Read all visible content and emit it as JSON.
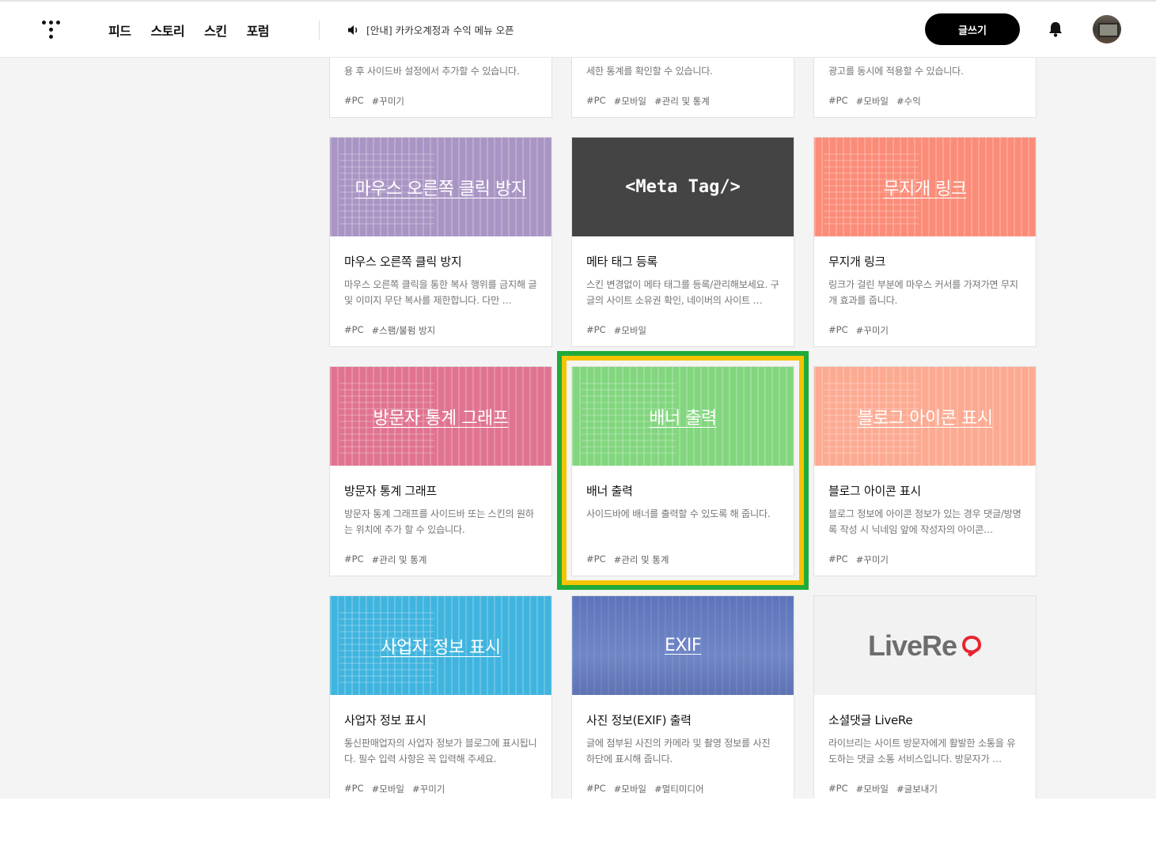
{
  "header": {
    "nav": [
      "피드",
      "스토리",
      "스킨",
      "포럼"
    ],
    "notice": "[안내] 카카오계정과 수익 메뉴 오픈",
    "write_button": "글쓰기"
  },
  "cards": [
    {
      "thumb_text": "",
      "title": "",
      "desc": "용 후 사이드바 설정에서 추가할 수 있습니다.",
      "tags": [
        "#PC",
        "#꾸미기"
      ],
      "color": "#ffffff"
    },
    {
      "thumb_text": "",
      "title": "",
      "desc": "세한 통계를 확인할 수 있습니다.",
      "tags": [
        "#PC",
        "#모바일",
        "#관리 및 통계"
      ],
      "color": "#ffffff"
    },
    {
      "thumb_text": "",
      "title": "",
      "desc": "광고를 동시에 적용할 수 있습니다.",
      "tags": [
        "#PC",
        "#모바일",
        "#수익"
      ],
      "color": "#ffffff"
    },
    {
      "thumb_text": "마우스 오른쪽 클릭 방지",
      "title": "마우스 오른쪽 클릭 방지",
      "desc": "마우스 오른쪽 클릭을 통한 복사 행위를 금지해 글 및 이미지 무단 복사를 제한합니다. 다만 …",
      "tags": [
        "#PC",
        "#스팸/불펌 방지"
      ],
      "color": "#a995c4"
    },
    {
      "thumb_text": "<Meta Tag/>",
      "title": "메타 태그 등록",
      "desc": "스킨 변경없이 메타 태그를 등록/관리해보세요. 구글의 사이트 소유권 확인, 네이버의 사이트 …",
      "tags": [
        "#PC",
        "#모바일"
      ],
      "color": "#444444"
    },
    {
      "thumb_text": "무지개 링크",
      "title": "무지개 링크",
      "desc": "링크가 걸린 부분에 마우스 커서를 가져가면 무지개 효과를 줍니다.",
      "tags": [
        "#PC",
        "#꾸미기"
      ],
      "color": "#fb8c78"
    },
    {
      "thumb_text": "방문자 통계 그래프",
      "title": "방문자 통계 그래프",
      "desc": "방문자 통계 그래프를 사이드바 또는 스킨의 원하는 위치에 추가 할 수 있습니다.",
      "tags": [
        "#PC",
        "#관리 및 통계"
      ],
      "color": "#e07390"
    },
    {
      "thumb_text": "배너 출력",
      "title": "배너 출력",
      "desc": "사이드바에 배너를 출력할 수 있도록 해 줍니다.",
      "tags": [
        "#PC",
        "#관리 및 통계"
      ],
      "color": "#82d67e"
    },
    {
      "thumb_text": "블로그 아이콘 표시",
      "title": "블로그 아이콘 표시",
      "desc": "블로그 정보에 아이콘 정보가 있는 경우 댓글/방명록 작성 시 닉네임 앞에 작성자의 아이콘…",
      "tags": [
        "#PC",
        "#꾸미기"
      ],
      "color": "#fdaa92"
    },
    {
      "thumb_text": "사업자 정보 표시",
      "title": "사업자 정보 표시",
      "desc": "통신판매업자의 사업자 정보가 블로그에 표시됩니다. 필수 입력 사항은 꼭 입력해 주세요.",
      "tags": [
        "#PC",
        "#모바일",
        "#꾸미기"
      ],
      "color": "#3fb4de"
    },
    {
      "thumb_text": "EXIF",
      "title": "사진 정보(EXIF) 출력",
      "desc": "글에 첨부된 사진의 카메라 및 촬영 정보를 사진 하단에 표시해 줍니다.",
      "tags": [
        "#PC",
        "#모바일",
        "#멀티미디어"
      ],
      "color": "#6a80c1"
    },
    {
      "thumb_text": "LiveRe",
      "title": "소셜댓글 LiveRe",
      "desc": "라이브리는 사이트 방문자에게 활발한 소통을 유도하는 댓글 소통 서비스입니다. 방문자가 …",
      "tags": [
        "#PC",
        "#모바일",
        "#글보내기"
      ],
      "color": "#f2f2f2"
    }
  ]
}
